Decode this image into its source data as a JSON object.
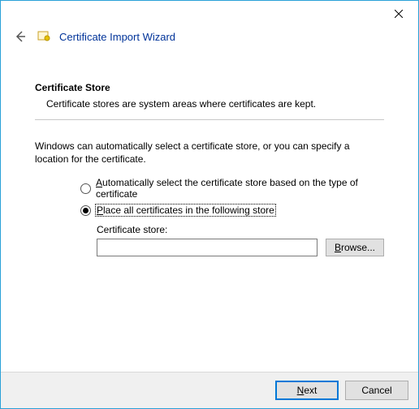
{
  "window": {
    "title": "Certificate Import Wizard"
  },
  "section": {
    "heading": "Certificate Store",
    "description": "Certificate stores are system areas where certificates are kept."
  },
  "body": {
    "intro": "Windows can automatically select a certificate store, or you can specify a location for the certificate.",
    "radio_auto_pre": "A",
    "radio_auto_rest": "utomatically select the certificate store based on the type of certificate",
    "radio_manual_pre": "P",
    "radio_manual_rest": "lace all certificates in the following store",
    "store_label": "Certificate store:",
    "store_value": "",
    "browse_pre": "B",
    "browse_rest": "rowse..."
  },
  "footer": {
    "next_pre": "N",
    "next_rest": "ext",
    "cancel": "Cancel"
  }
}
